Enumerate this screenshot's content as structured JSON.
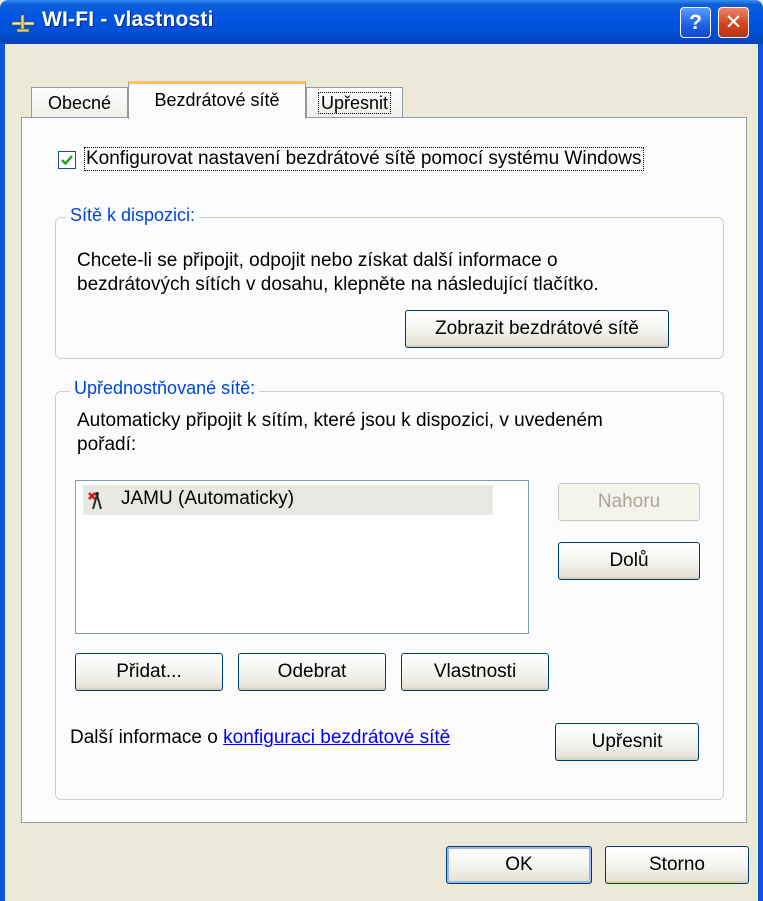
{
  "window": {
    "title": "WI-FI - vlastnosti",
    "help_button": "?",
    "close_button": "✕"
  },
  "tabs": [
    {
      "label": "Obecné",
      "active": false
    },
    {
      "label": "Bezdrátové sítě",
      "active": true
    },
    {
      "label": "Upřesnit",
      "active": false
    }
  ],
  "configure_checkbox": {
    "checked": true,
    "label": "Konfigurovat nastavení bezdrátové sítě pomocí systému Windows"
  },
  "available_networks": {
    "title": "Sítě k dispozici:",
    "description_line1": "Chcete-li se připojit, odpojit nebo získat další informace o",
    "description_line2": "bezdrátových sítích v dosahu, klepněte na následující tlačítko.",
    "view_button": "Zobrazit bezdrátové sítě"
  },
  "preferred_networks": {
    "title": "Upřednostňované sítě:",
    "description_line1": "Automaticky připojit k sítím, které jsou k dispozici, v uvedeném",
    "description_line2": "pořadí:",
    "items": [
      {
        "label": "JAMU (Automaticky)",
        "icon": "wireless-network-disconnected-icon"
      }
    ],
    "up_button": "Nahoru",
    "down_button": "Dolů",
    "add_button": "Přidat...",
    "remove_button": "Odebrat",
    "properties_button": "Vlastnosti"
  },
  "info": {
    "prefix": "Další informace o ",
    "link": "konfiguraci bezdrátové sítě",
    "advanced_button": "Upřesnit"
  },
  "footer": {
    "ok_button": "OK",
    "cancel_button": "Storno"
  },
  "colors": {
    "titlebar": "#0054e3",
    "tab_highlight": "#ffc83c",
    "group_title": "#0046d5",
    "link": "#0000ff",
    "close_button": "#d6421a"
  }
}
